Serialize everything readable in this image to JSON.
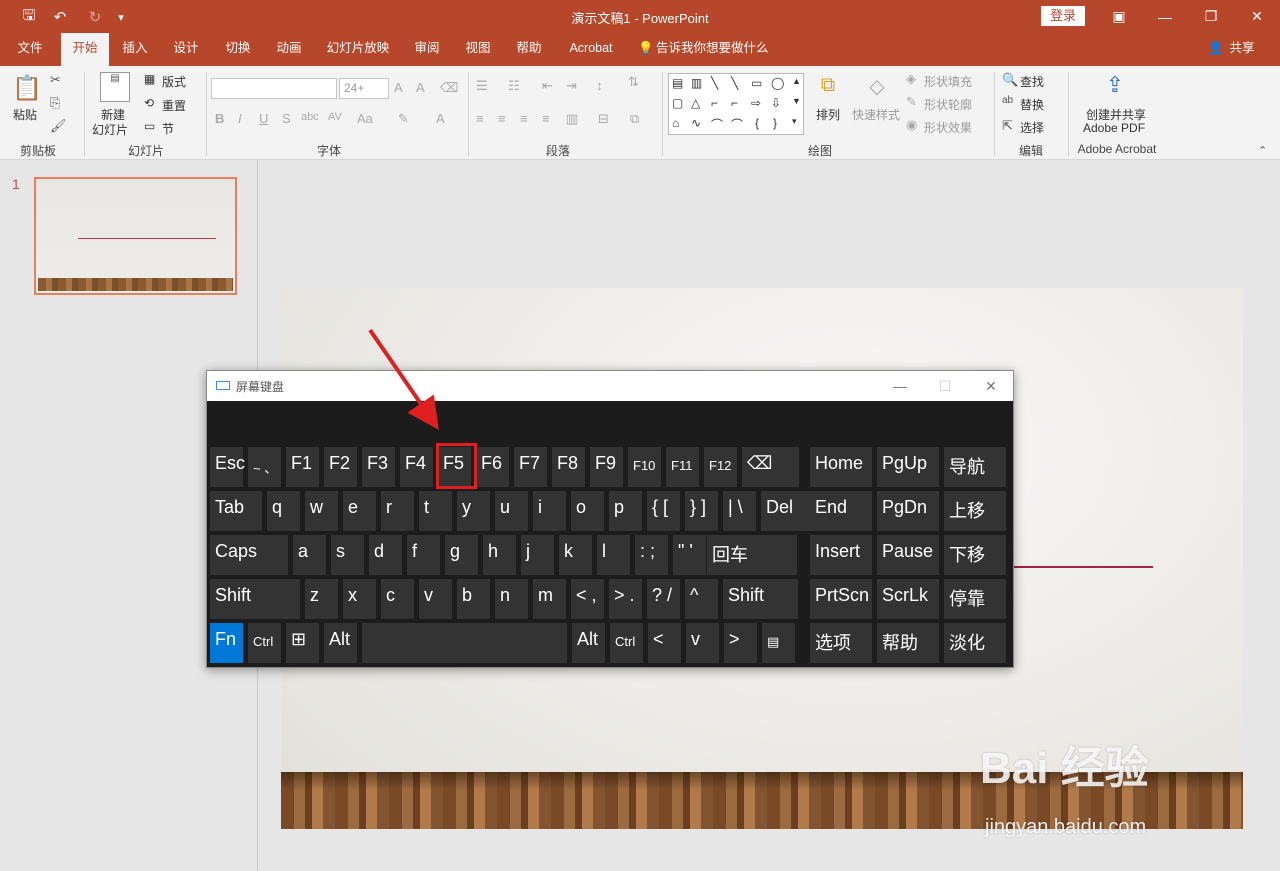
{
  "app": {
    "title": "演示文稿1  -  PowerPoint",
    "login": "登录",
    "share": "共享",
    "tell_me": "告诉我你想要做什么"
  },
  "tabs": [
    "文件",
    "开始",
    "插入",
    "设计",
    "切换",
    "动画",
    "幻灯片放映",
    "审阅",
    "视图",
    "帮助",
    "Acrobat"
  ],
  "ribbon": {
    "clipboard": {
      "label": "剪贴板",
      "paste": "粘贴"
    },
    "slides": {
      "label": "幻灯片",
      "new_slide_1": "新建",
      "new_slide_2": "幻灯片",
      "layout": "版式",
      "reset": "重置",
      "section": "节"
    },
    "font": {
      "label": "字体",
      "font_size": "24+"
    },
    "paragraph": {
      "label": "段落"
    },
    "drawing": {
      "label": "绘图",
      "arrange": "排列",
      "quick_styles": "快速样式",
      "shape_fill": "形状填充",
      "shape_outline": "形状轮廓",
      "shape_effects": "形状效果"
    },
    "editing": {
      "label": "编辑",
      "find": "查找",
      "replace": "替换",
      "select": "选择"
    },
    "acrobat": {
      "label": "Adobe Acrobat",
      "create_1": "创建并共享",
      "create_2": "Adobe PDF"
    }
  },
  "slide_panel": {
    "slide_number": "1"
  },
  "watermark": {
    "brand": "Bai 经验",
    "url": "jingyan.baidu.com"
  },
  "osk": {
    "title": "屏幕键盘",
    "row1": [
      "Esc",
      "~ 、",
      "F1",
      "F2",
      "F3",
      "F4",
      "F5",
      "F6",
      "F7",
      "F8",
      "F9",
      "F10",
      "F11",
      "F12",
      "⌫",
      "Home",
      "PgUp",
      "导航"
    ],
    "row2": [
      "Tab",
      "q",
      "w",
      "e",
      "r",
      "t",
      "y",
      "u",
      "i",
      "o",
      "p",
      "{ [",
      "} ]",
      "| \\",
      "Del",
      "End",
      "PgDn",
      "上移"
    ],
    "row3": [
      "Caps",
      "a",
      "s",
      "d",
      "f",
      "g",
      "h",
      "j",
      "k",
      "l",
      ": ;",
      "\" '",
      "回车",
      "Insert",
      "Pause",
      "下移"
    ],
    "row4": [
      "Shift",
      "z",
      "x",
      "c",
      "v",
      "b",
      "n",
      "m",
      "< ,",
      "> .",
      "? /",
      "^",
      "Shift",
      "PrtScn",
      "ScrLk",
      "停靠"
    ],
    "row5": [
      "Fn",
      "Ctrl",
      "⊞",
      "Alt",
      "",
      "Alt",
      "Ctrl",
      "<",
      "v",
      ">",
      "▤",
      "选项",
      "帮助",
      "淡化"
    ]
  }
}
